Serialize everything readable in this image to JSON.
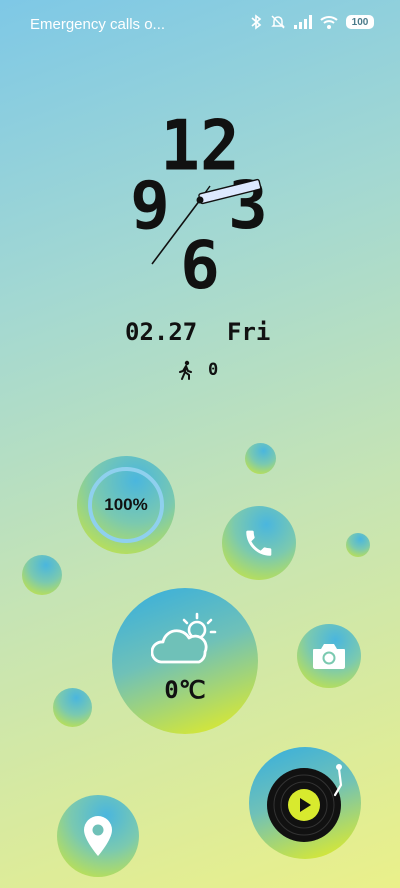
{
  "status_bar": {
    "text": "Emergency calls o...",
    "battery_level": "100",
    "icons": [
      "bluetooth-icon",
      "mute-icon",
      "signal-icon",
      "wifi-icon",
      "battery-icon"
    ]
  },
  "clock": {
    "numerals": [
      "12",
      "9",
      "3",
      "6"
    ],
    "time_display": "analog"
  },
  "date": {
    "date": "02.27",
    "day": "Fri"
  },
  "steps": {
    "count": "0",
    "icon": "walking-icon"
  },
  "widgets": {
    "battery_percent": "100%",
    "battery_ring_fraction": 0.96,
    "weather_temp": "0℃",
    "weather_icon": "cloud-sun-icon",
    "phone_icon": "phone-icon",
    "camera_icon": "camera-icon",
    "music_icon": "vinyl-record-icon",
    "maps_icon": "location-pin-icon"
  },
  "colors": {
    "bubble_blue": "#35aedf",
    "bubble_yellow": "#e8ee1f",
    "ring_color": "#8fd0ee",
    "text_dark": "#111111"
  }
}
